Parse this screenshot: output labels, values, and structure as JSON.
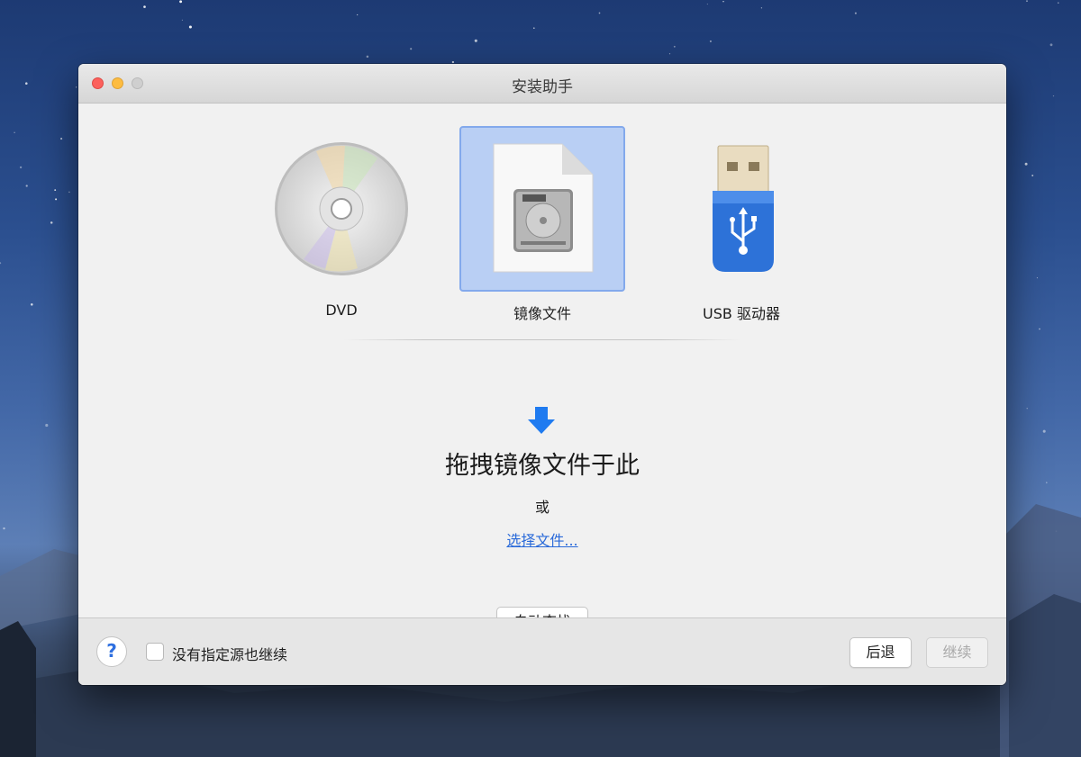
{
  "window": {
    "title": "安装助手"
  },
  "sources": [
    {
      "label": "DVD",
      "icon": "dvd-disc-icon"
    },
    {
      "label": "镜像文件",
      "icon": "image-file-icon",
      "selected": true
    },
    {
      "label": "USB 驱动器",
      "icon": "usb-drive-icon"
    }
  ],
  "drop_area": {
    "title": "拖拽镜像文件于此",
    "or_text": "或",
    "choose_link": "选择文件..."
  },
  "buttons": {
    "auto_find": "自动查找",
    "back": "后退",
    "continue": "继续"
  },
  "footer": {
    "help_label": "?",
    "checkbox_label": "没有指定源也继续",
    "checkbox_checked": false
  },
  "colors": {
    "selection": "#b9cff4",
    "accent": "#2d6fe0",
    "link": "#2a6ad9",
    "close": "#fc605c",
    "minimize": "#fdbc40"
  }
}
